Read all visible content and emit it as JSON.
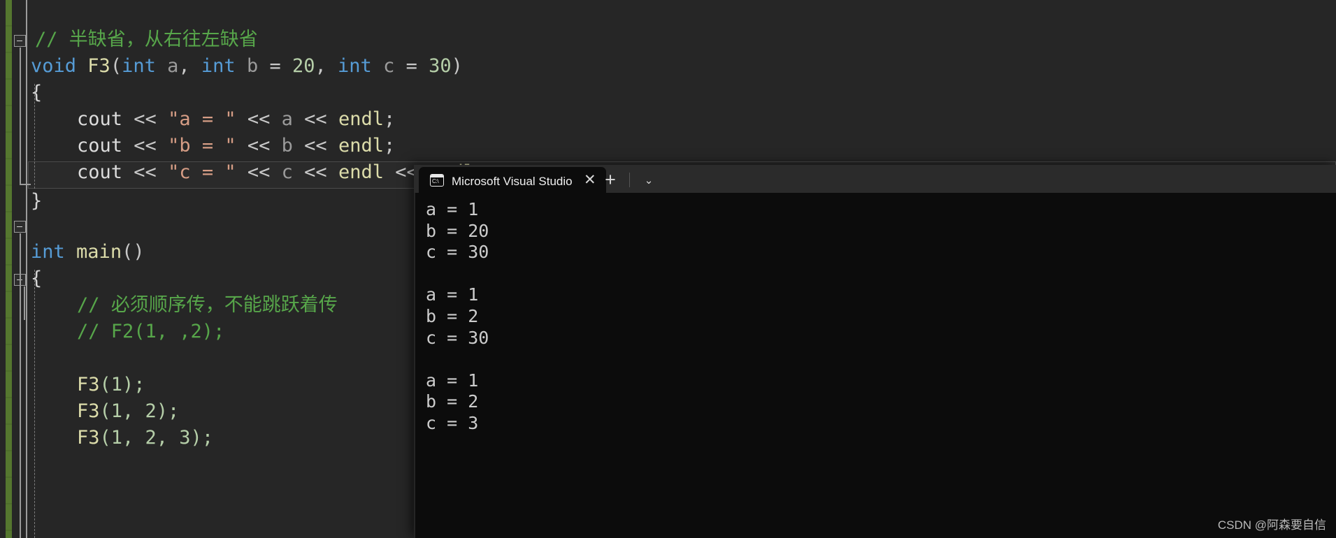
{
  "editor": {
    "theme_background": "#262626",
    "change_bar_color": "#55772f",
    "colors": {
      "comment": "#57a64a",
      "keyword": "#569cd6",
      "function": "#dcdcaa",
      "string": "#d69d85",
      "number": "#b5cea8",
      "plain": "#dcdcdc",
      "variable": "#9b9b9b"
    },
    "lines": [
      {
        "indent": 1,
        "text": "// 半缺省，从右往左缺省",
        "kind": "comment"
      },
      {
        "indent": 0,
        "text": "void F3(int a, int b = 20, int c = 30)",
        "kind": "signature"
      },
      {
        "indent": 0,
        "text": "{",
        "kind": "brace"
      },
      {
        "indent": 2,
        "text": "cout << \"a = \" << a << endl;",
        "kind": "cout"
      },
      {
        "indent": 2,
        "text": "cout << \"b = \" << b << endl;",
        "kind": "cout"
      },
      {
        "indent": 2,
        "text": "cout << \"c = \" << c << endl << endl;",
        "kind": "cout"
      },
      {
        "indent": 0,
        "text": "}",
        "kind": "brace-highlight"
      },
      {
        "indent": 0,
        "text": "",
        "kind": "blank"
      },
      {
        "indent": 0,
        "text": "int main()",
        "kind": "signature"
      },
      {
        "indent": 0,
        "text": "{",
        "kind": "brace"
      },
      {
        "indent": 2,
        "text": "// 必须顺序传，不能跳跃着传",
        "kind": "comment"
      },
      {
        "indent": 2,
        "text": "// F2(1, ,2);",
        "kind": "comment"
      },
      {
        "indent": 0,
        "text": "",
        "kind": "blank"
      },
      {
        "indent": 2,
        "text": "F3(1);",
        "kind": "call"
      },
      {
        "indent": 2,
        "text": "F3(1, 2);",
        "kind": "call"
      },
      {
        "indent": 2,
        "text": "F3(1, 2, 3);",
        "kind": "call"
      }
    ],
    "tokens": {
      "comment_1": "// 半缺省，从右往左缺省",
      "sig_f3_kw1": "void",
      "sig_f3_name": "F3",
      "sig_f3_open": "(",
      "sig_f3_kw2": "int",
      "sig_f3_a": "a",
      "sig_f3_comma1": ", ",
      "sig_f3_kw3": "int",
      "sig_f3_b": "b",
      "sig_f3_eq1": " = ",
      "sig_f3_num1": "20",
      "sig_f3_comma2": ", ",
      "sig_f3_kw4": "int",
      "sig_f3_c": "c",
      "sig_f3_eq2": " = ",
      "sig_f3_num2": "30",
      "sig_f3_close": ")",
      "brace_open_f3": "{",
      "brace_close_f3": "}",
      "cout": "cout",
      "shift": " << ",
      "str_a": "\"a = \"",
      "str_b": "\"b = \"",
      "str_c": "\"c = \"",
      "var_a": "a",
      "var_b": "b",
      "var_c": "c",
      "endl": "endl",
      "semicolon": ";",
      "sig_main_kw": "int",
      "sig_main_name": "main",
      "sig_main_parens": "()",
      "brace_open_main": "{",
      "comment_2": "// 必须顺序传，不能跳跃着传",
      "comment_3": "// F2(1, ,2);",
      "call_f3_name": "F3",
      "call_1": "(1);",
      "call_2": "(1, 2);",
      "call_3": "(1, 2, 3);"
    }
  },
  "terminal": {
    "tab": {
      "title": "Microsoft Visual Studio 调试控",
      "icon": "console-icon",
      "icon_label": "C:\\",
      "close_label": "✕",
      "new_tab_label": "+",
      "menu_label": "⌄"
    },
    "background": "#0c0c0c",
    "output_blocks": [
      {
        "lines": [
          "a = 1",
          "b = 20",
          "c = 30"
        ]
      },
      {
        "lines": [
          "a = 1",
          "b = 2",
          "c = 30"
        ]
      },
      {
        "lines": [
          "a = 1",
          "b = 2",
          "c = 3"
        ]
      }
    ],
    "output_flat": [
      "a = 1",
      "b = 20",
      "c = 30",
      "",
      "a = 1",
      "b = 2",
      "c = 30",
      "",
      "a = 1",
      "b = 2",
      "c = 3"
    ]
  },
  "watermark": {
    "text": "CSDN @阿森要自信"
  }
}
